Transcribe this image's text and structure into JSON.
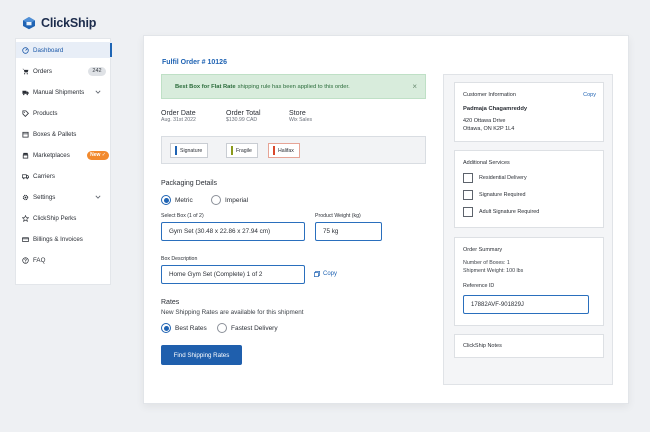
{
  "brand": {
    "name": "ClickShip"
  },
  "sidebar": {
    "items": [
      {
        "label": "Dashboard",
        "icon": "dashboard-icon",
        "active": true
      },
      {
        "label": "Orders",
        "icon": "cart-icon",
        "badge": "242"
      },
      {
        "label": "Manual Shipments",
        "icon": "truck-icon",
        "chevron": true
      },
      {
        "label": "Products",
        "icon": "tag-icon"
      },
      {
        "label": "Boxes & Pallets",
        "icon": "box-icon"
      },
      {
        "label": "Marketplaces",
        "icon": "store-icon",
        "new_badge": "New ✓"
      },
      {
        "label": "Carriers",
        "icon": "carrier-icon"
      },
      {
        "label": "Settings",
        "icon": "gear-icon",
        "chevron": true
      },
      {
        "label": "ClickShip Perks",
        "icon": "star-icon"
      },
      {
        "label": "Billings & Invoices",
        "icon": "billing-icon"
      },
      {
        "label": "FAQ",
        "icon": "help-icon"
      }
    ]
  },
  "main": {
    "title": "Fulfil Order # 10126",
    "alert": {
      "bold": "Best Box for Flat Rate",
      "text": "shipping rule has been applied to this order.",
      "close": "×"
    },
    "meta": [
      {
        "label": "Order Date",
        "value": "Aug. 31st 2022"
      },
      {
        "label": "Order Total",
        "value": "$130.99 CAD"
      },
      {
        "label": "Store",
        "value": "Wix Sales"
      }
    ],
    "tags": [
      {
        "label": "Signature",
        "color": "#1f63b3"
      },
      {
        "label": "Fragile",
        "color": "#8a9a1c"
      },
      {
        "label": "Halifax",
        "color": "#d9482b"
      }
    ],
    "packaging": {
      "title": "Packaging Details",
      "units": [
        "Metric",
        "Imperial"
      ],
      "selected_unit": "Metric",
      "select_box_label": "Select Box (1 of 2)",
      "select_box_value": "Gym Set (30.48 x 22.86 x 27.94 cm)",
      "weight_label": "Product Weight (kg)",
      "weight_value": "75 kg",
      "description_label": "Box Description",
      "description_value": "Home Gym Set (Complete) 1 of 2",
      "copy_label": "Copy"
    },
    "rates": {
      "title": "Rates",
      "subtitle": "New Shipping Rates are available for this shipment",
      "options": [
        "Best Rates",
        "Fastest Delivery"
      ],
      "selected": "Best Rates",
      "button": "Find Shipping Rates"
    }
  },
  "side": {
    "customer": {
      "title": "Customer Information",
      "copy": "Copy",
      "name": "Padmaja Chagamreddy",
      "address1": "420 Ottawa Drive",
      "address2": "Ottawa, ON K2P 1L4"
    },
    "services": {
      "title": "Additional Services",
      "options": [
        "Residential Delivery",
        "Signature Required",
        "Adult Signature Required"
      ]
    },
    "summary": {
      "title": "Order Summary",
      "boxes": "Number of Boxes: 1",
      "weight": "Shipment Weight: 100 lbs",
      "reference_label": "Reference ID",
      "reference_value": "17882AVF-901829J"
    },
    "notes": {
      "title": "ClickShip Notes"
    }
  }
}
